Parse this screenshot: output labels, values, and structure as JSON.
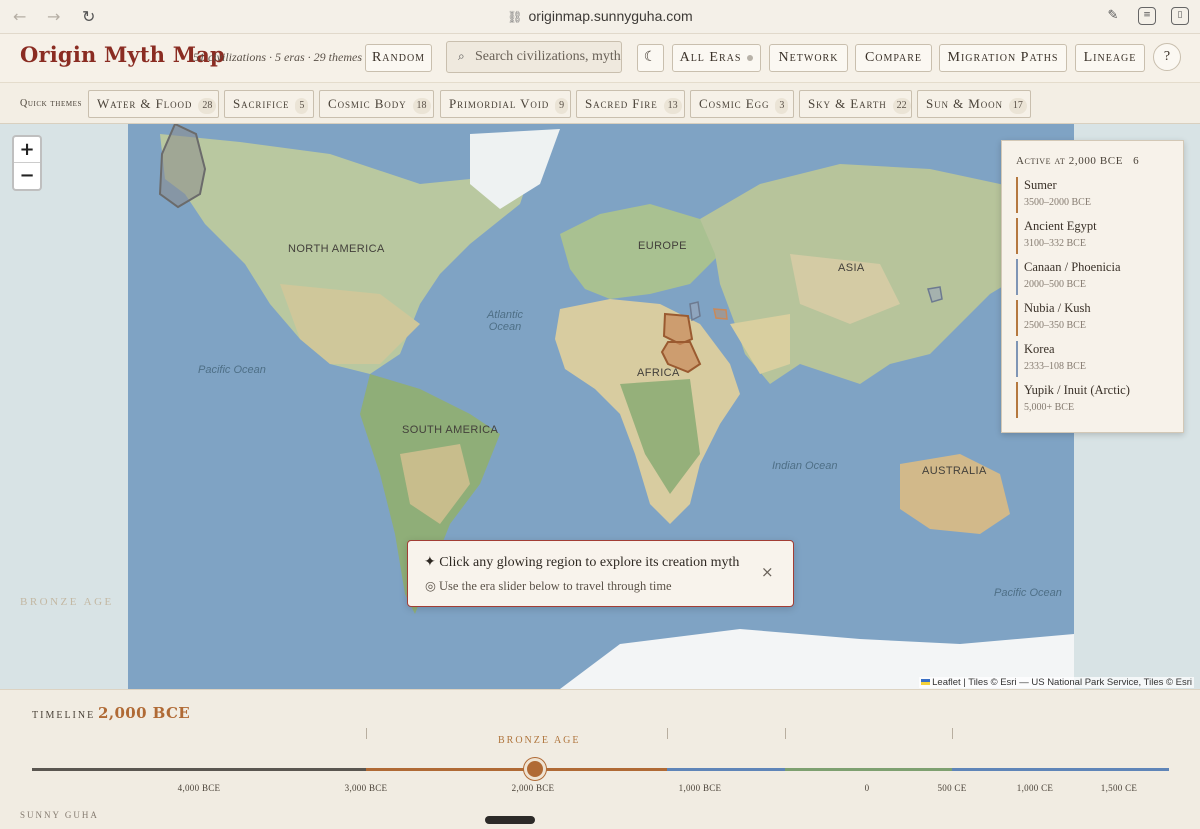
{
  "browser": {
    "url": "originmap.sunnyguha.com"
  },
  "app": {
    "title": "Origin Myth Map",
    "subtitle": "51 civilizations · 5 eras · 29 themes",
    "random_label": "Random",
    "search_placeholder": "Search civilizations, myth",
    "theme_toggle": "☾",
    "era_select": "All Eras",
    "network_label": "Network",
    "compare_label": "Compare",
    "migration_label": "Migration Paths",
    "lineage_label": "Lineage",
    "help_label": "?"
  },
  "quick_themes": {
    "label": "Quick themes",
    "items": [
      {
        "label": "Water & Flood",
        "count": "28"
      },
      {
        "label": "Sacrifice",
        "count": "5"
      },
      {
        "label": "Cosmic Body",
        "count": "18"
      },
      {
        "label": "Primordial Void",
        "count": "9"
      },
      {
        "label": "Sacred Fire",
        "count": "13"
      },
      {
        "label": "Cosmic Egg",
        "count": "3"
      },
      {
        "label": "Sky & Earth",
        "count": "22"
      },
      {
        "label": "Sun & Moon",
        "count": "17"
      }
    ]
  },
  "map": {
    "zoom_in": "+",
    "zoom_out": "−",
    "labels": {
      "north_america": "NORTH AMERICA",
      "south_america": "SOUTH AMERICA",
      "europe": "EUROPE",
      "africa": "AFRICA",
      "asia": "ASIA",
      "australia": "AUSTRALIA",
      "pacific_west": "Pacific Ocean",
      "pacific_east": "Pacific Ocean",
      "atlantic": "Atlantic Ocean",
      "indian": "Indian Ocean"
    },
    "era_watermark": "BRONZE AGE",
    "attribution": "Leaflet | Tiles © Esri — US National Park Service, Tiles © Esri"
  },
  "active_panel": {
    "header": "Active at 2,000 BCE",
    "count": "6",
    "items": [
      {
        "name": "Sumer",
        "dates": "3500–2000 BCE",
        "color": "#b5783f"
      },
      {
        "name": "Ancient Egypt",
        "dates": "3100–332 BCE",
        "color": "#b5783f"
      },
      {
        "name": "Canaan / Phoenicia",
        "dates": "2000–500 BCE",
        "color": "#7f95b5"
      },
      {
        "name": "Nubia / Kush",
        "dates": "2500–350 BCE",
        "color": "#b5783f"
      },
      {
        "name": "Korea",
        "dates": "2333–108 BCE",
        "color": "#7f95b5"
      },
      {
        "name": "Yupik / Inuit (Arctic)",
        "dates": "5,000+ BCE",
        "color": "#b5783f"
      }
    ]
  },
  "hint": {
    "line1": "✦ Click any glowing region to explore its creation myth",
    "line2": "◎ Use the era slider below to travel through time",
    "close": "×"
  },
  "timeline": {
    "label": "TIMELINE",
    "value": "2,000 BCE",
    "era_name": "BRONZE AGE",
    "ticks": [
      "4,000 BCE",
      "3,000 BCE",
      "2,000 BCE",
      "1,000 BCE",
      "0",
      "500 CE",
      "1,000 CE",
      "1,500 CE"
    ],
    "credit": "SUNNY GUHA"
  },
  "colors": {
    "accent": "#8a2c22",
    "bronze": "#b06a35",
    "region_fill": "#c9895a",
    "track_grey": "#5a5650",
    "track_bronze": "#b06a35",
    "track_blue": "#5f85b8",
    "track_green": "#7ea070"
  }
}
